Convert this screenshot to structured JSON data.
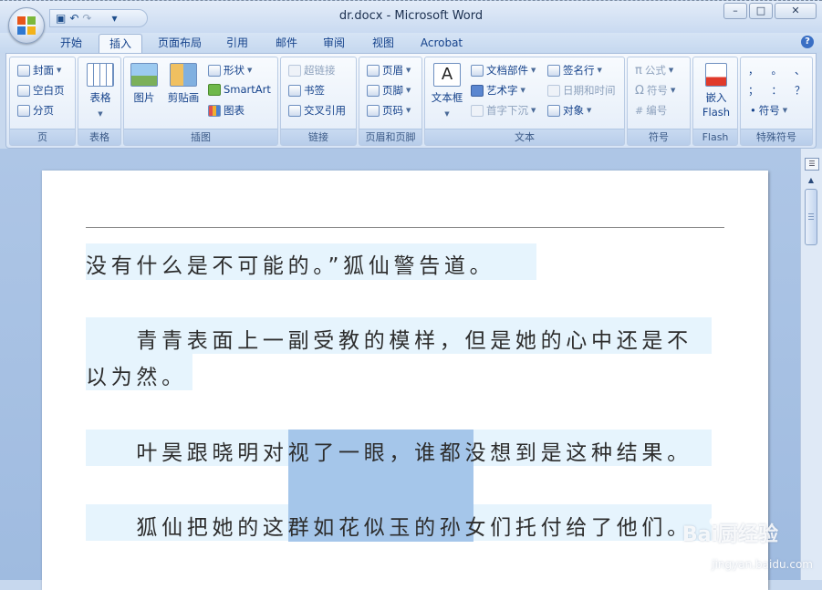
{
  "window": {
    "title": "dr.docx - Microsoft Word",
    "minimize": "–",
    "maximize": "□",
    "close": "✕"
  },
  "qat": {
    "save": "💾",
    "undo": "↶",
    "redo": "↷",
    "customize": "▾"
  },
  "tabs": [
    "开始",
    "插入",
    "页面布局",
    "引用",
    "邮件",
    "审阅",
    "视图",
    "Acrobat"
  ],
  "active_tab": "插入",
  "help": "?",
  "ribbon": {
    "page": {
      "label": "页",
      "items": [
        "封面",
        "空白页",
        "分页"
      ]
    },
    "table": {
      "label": "表格",
      "button": "表格"
    },
    "illustrations": {
      "label": "插图",
      "picture": "图片",
      "clipart": "剪贴画",
      "shapes": "形状",
      "smartart": "SmartArt",
      "chart": "图表"
    },
    "links": {
      "label": "链接",
      "hyperlink": "超链接",
      "bookmark": "书签",
      "crossref": "交叉引用"
    },
    "headerfooter": {
      "label": "页眉和页脚",
      "header": "页眉",
      "footer": "页脚",
      "pagenum": "页码"
    },
    "text": {
      "label": "文本",
      "textbox": "文本框",
      "quickparts": "文档部件",
      "wordart": "艺术字",
      "dropcap": "首字下沉",
      "signature": "签名行",
      "datetime": "日期和时间",
      "object": "对象"
    },
    "symbols": {
      "label": "符号",
      "equation": "公式",
      "symbol": "符号",
      "number": "编号"
    },
    "flash": {
      "label": "Flash",
      "button_line1": "嵌入",
      "button_line2": "Flash"
    },
    "special": {
      "label": "特殊符号",
      "glyph1": "，",
      "glyph2": "。",
      "glyph3": "、",
      "glyph4": "；",
      "glyph5": "：",
      "glyph6": "？",
      "symbol": "符号"
    }
  },
  "document": {
    "lines": [
      "没有什么是不可能的。”狐仙警告道。",
      "　　青青表面上一副受教的模样，但是她的心中还是不",
      "以为然。",
      "　　叶昊跟晓明对视了一眼，谁都没想到是这种结果。",
      "　　狐仙把她的这群如花似玉的孙女们托付给了他们。"
    ]
  },
  "watermark": {
    "brand": "Bai厨经验",
    "url": "jingyan.baidu.com"
  }
}
